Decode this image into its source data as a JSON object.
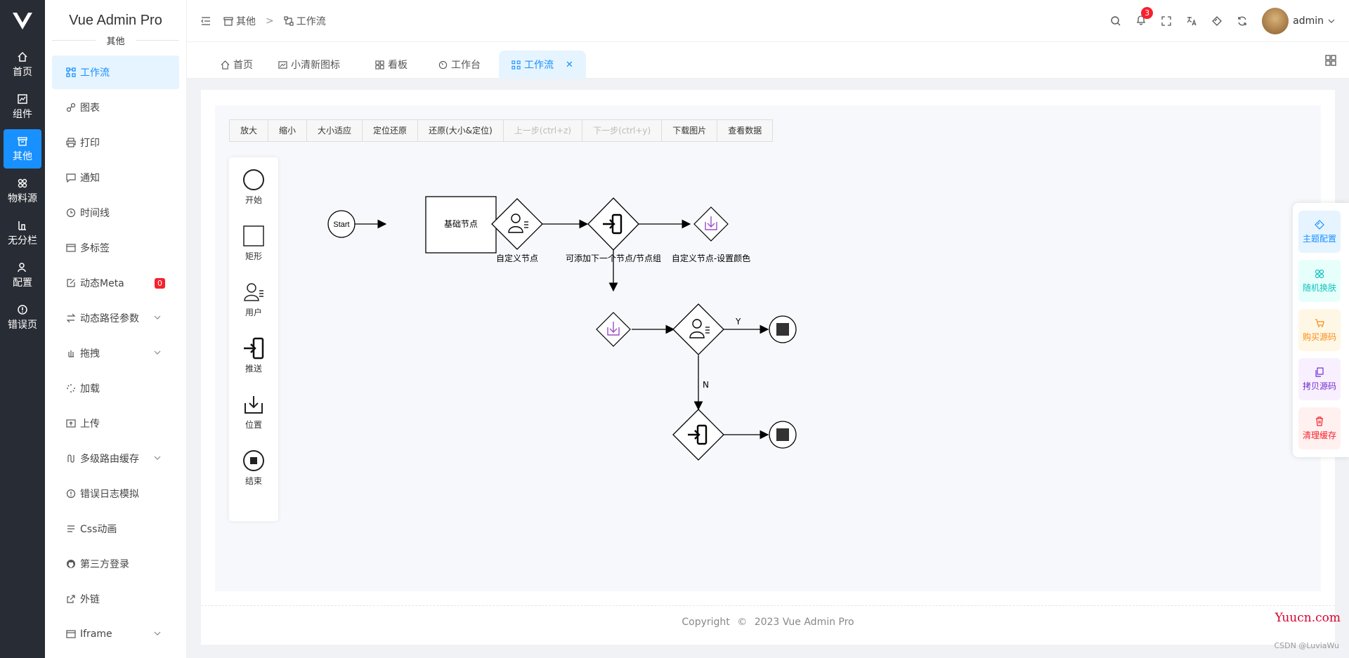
{
  "app": {
    "title": "Vue Admin Pro",
    "section": "其他"
  },
  "rail": [
    {
      "label": "首页",
      "icon": "home-icon"
    },
    {
      "label": "组件",
      "icon": "component-icon"
    },
    {
      "label": "其他",
      "icon": "archive-icon",
      "active": true
    },
    {
      "label": "物料源",
      "icon": "material-icon"
    },
    {
      "label": "无分栏",
      "icon": "column-icon"
    },
    {
      "label": "配置",
      "icon": "user-config-icon"
    },
    {
      "label": "错误页",
      "icon": "error-icon"
    }
  ],
  "menu": [
    {
      "label": "工作流",
      "icon": "workflow-icon",
      "active": true
    },
    {
      "label": "图表",
      "icon": "chart-icon"
    },
    {
      "label": "打印",
      "icon": "printer-icon"
    },
    {
      "label": "通知",
      "icon": "message-icon"
    },
    {
      "label": "时间线",
      "icon": "clock-icon"
    },
    {
      "label": "多标签",
      "icon": "tabs-icon"
    },
    {
      "label": "动态Meta",
      "icon": "edit-icon",
      "badge": "0"
    },
    {
      "label": "动态路径参数",
      "icon": "swap-icon",
      "expandable": true
    },
    {
      "label": "拖拽",
      "icon": "drag-icon",
      "expandable": true
    },
    {
      "label": "加载",
      "icon": "loading-icon"
    },
    {
      "label": "上传",
      "icon": "upload-icon"
    },
    {
      "label": "多级路由缓存",
      "icon": "route-icon",
      "expandable": true
    },
    {
      "label": "错误日志模拟",
      "icon": "warning-icon"
    },
    {
      "label": "Css动画",
      "icon": "css-icon"
    },
    {
      "label": "第三方登录",
      "icon": "github-icon"
    },
    {
      "label": "外链",
      "icon": "external-link-icon"
    },
    {
      "label": "Iframe",
      "icon": "iframe-icon",
      "expandable": true
    }
  ],
  "header": {
    "breadcrumb": [
      "其他",
      "工作流"
    ],
    "breadcrumb_sep": ">",
    "notification_count": "3",
    "username": "admin"
  },
  "tabs": [
    {
      "label": "首页",
      "icon": "home-icon"
    },
    {
      "label": "小清新图标",
      "icon": "image-icon"
    },
    {
      "label": "看板",
      "icon": "dashboard-icon"
    },
    {
      "label": "工作台",
      "icon": "gauge-icon"
    },
    {
      "label": "工作流",
      "icon": "workflow-icon",
      "active": true
    }
  ],
  "toolbar": [
    {
      "label": "放大"
    },
    {
      "label": "缩小"
    },
    {
      "label": "大小适应"
    },
    {
      "label": "定位还原"
    },
    {
      "label": "还原(大小&定位)"
    },
    {
      "label": "上一步(ctrl+z)",
      "disabled": true
    },
    {
      "label": "下一步(ctrl+y)",
      "disabled": true
    },
    {
      "label": "下载图片"
    },
    {
      "label": "查看数据"
    }
  ],
  "palette": [
    {
      "label": "开始",
      "icon": "circle-icon"
    },
    {
      "label": "矩形",
      "icon": "square-icon"
    },
    {
      "label": "用户",
      "icon": "user-icon"
    },
    {
      "label": "推送",
      "icon": "push-icon"
    },
    {
      "label": "位置",
      "icon": "download-icon"
    },
    {
      "label": "结束",
      "icon": "stop-icon"
    }
  ],
  "flow": {
    "start_label": "Start",
    "base_node_label": "基础节点",
    "custom_node_label": "自定义节点",
    "add_next_label": "可添加下一个节点/节点组",
    "custom_color_label": "自定义节点-设置颜色",
    "yes_label": "Y",
    "no_label": "N"
  },
  "footer": {
    "copyright": "Copyright",
    "year_text": "2023 Vue Admin Pro"
  },
  "float_panel": [
    {
      "label": "主题配置",
      "icon": "theme-icon",
      "color": "#1890ff",
      "bg": "#e6f4ff"
    },
    {
      "label": "随机换肤",
      "icon": "skin-icon",
      "color": "#13c2c2",
      "bg": "#e6fffb"
    },
    {
      "label": "购买源码",
      "icon": "cart-icon",
      "color": "#fa8c16",
      "bg": "#fff7e6"
    },
    {
      "label": "拷贝源码",
      "icon": "copy-icon",
      "color": "#722ed1",
      "bg": "#f9f0ff"
    },
    {
      "label": "清理缓存",
      "icon": "trash-icon",
      "color": "#f5222d",
      "bg": "#fff1f0"
    }
  ],
  "watermark": {
    "site": "Yuucn.com",
    "author": "CSDN @LuviaWu"
  },
  "colors": {
    "primary": "#1890ff",
    "rail_bg": "#282c34",
    "purple_node": "#9b4dca"
  }
}
